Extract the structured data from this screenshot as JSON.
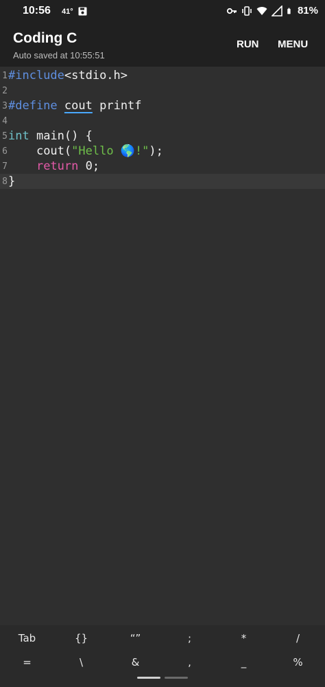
{
  "status_bar": {
    "time": "10:56",
    "temperature": "41°",
    "battery": "81%",
    "icons": [
      "save-icon",
      "key-icon",
      "vibrate-icon",
      "wifi-icon",
      "signal-icon",
      "battery-icon"
    ]
  },
  "app_bar": {
    "title": "Coding C",
    "subtitle": "Auto saved at 10:55:51",
    "run_label": "RUN",
    "menu_label": "MENU"
  },
  "editor": {
    "line_numbers": [
      "1",
      "2",
      "3",
      "4",
      "5",
      "6",
      "7",
      "8"
    ],
    "active_line": 8,
    "lines": {
      "l1_directive": "#include",
      "l1_header": "<stdio.h>",
      "l3_directive": "#define",
      "l3_macro": "cout",
      "l3_value": "printf",
      "l5_type": "int",
      "l5_rest": " main() {",
      "l6_indent": "    ",
      "l6_func": "cout(",
      "l6_string": "\"Hello 🌎!\"",
      "l6_end": ");",
      "l7_indent": "    ",
      "l7_keyword": "return",
      "l7_rest": " 0;",
      "l8_brace": "}"
    }
  },
  "keyboard_bar": {
    "row1": [
      "Tab",
      "{}",
      "“”",
      ";",
      "*",
      "/"
    ],
    "row2": [
      "=",
      "\\",
      "&",
      ",",
      "_",
      "%"
    ]
  }
}
